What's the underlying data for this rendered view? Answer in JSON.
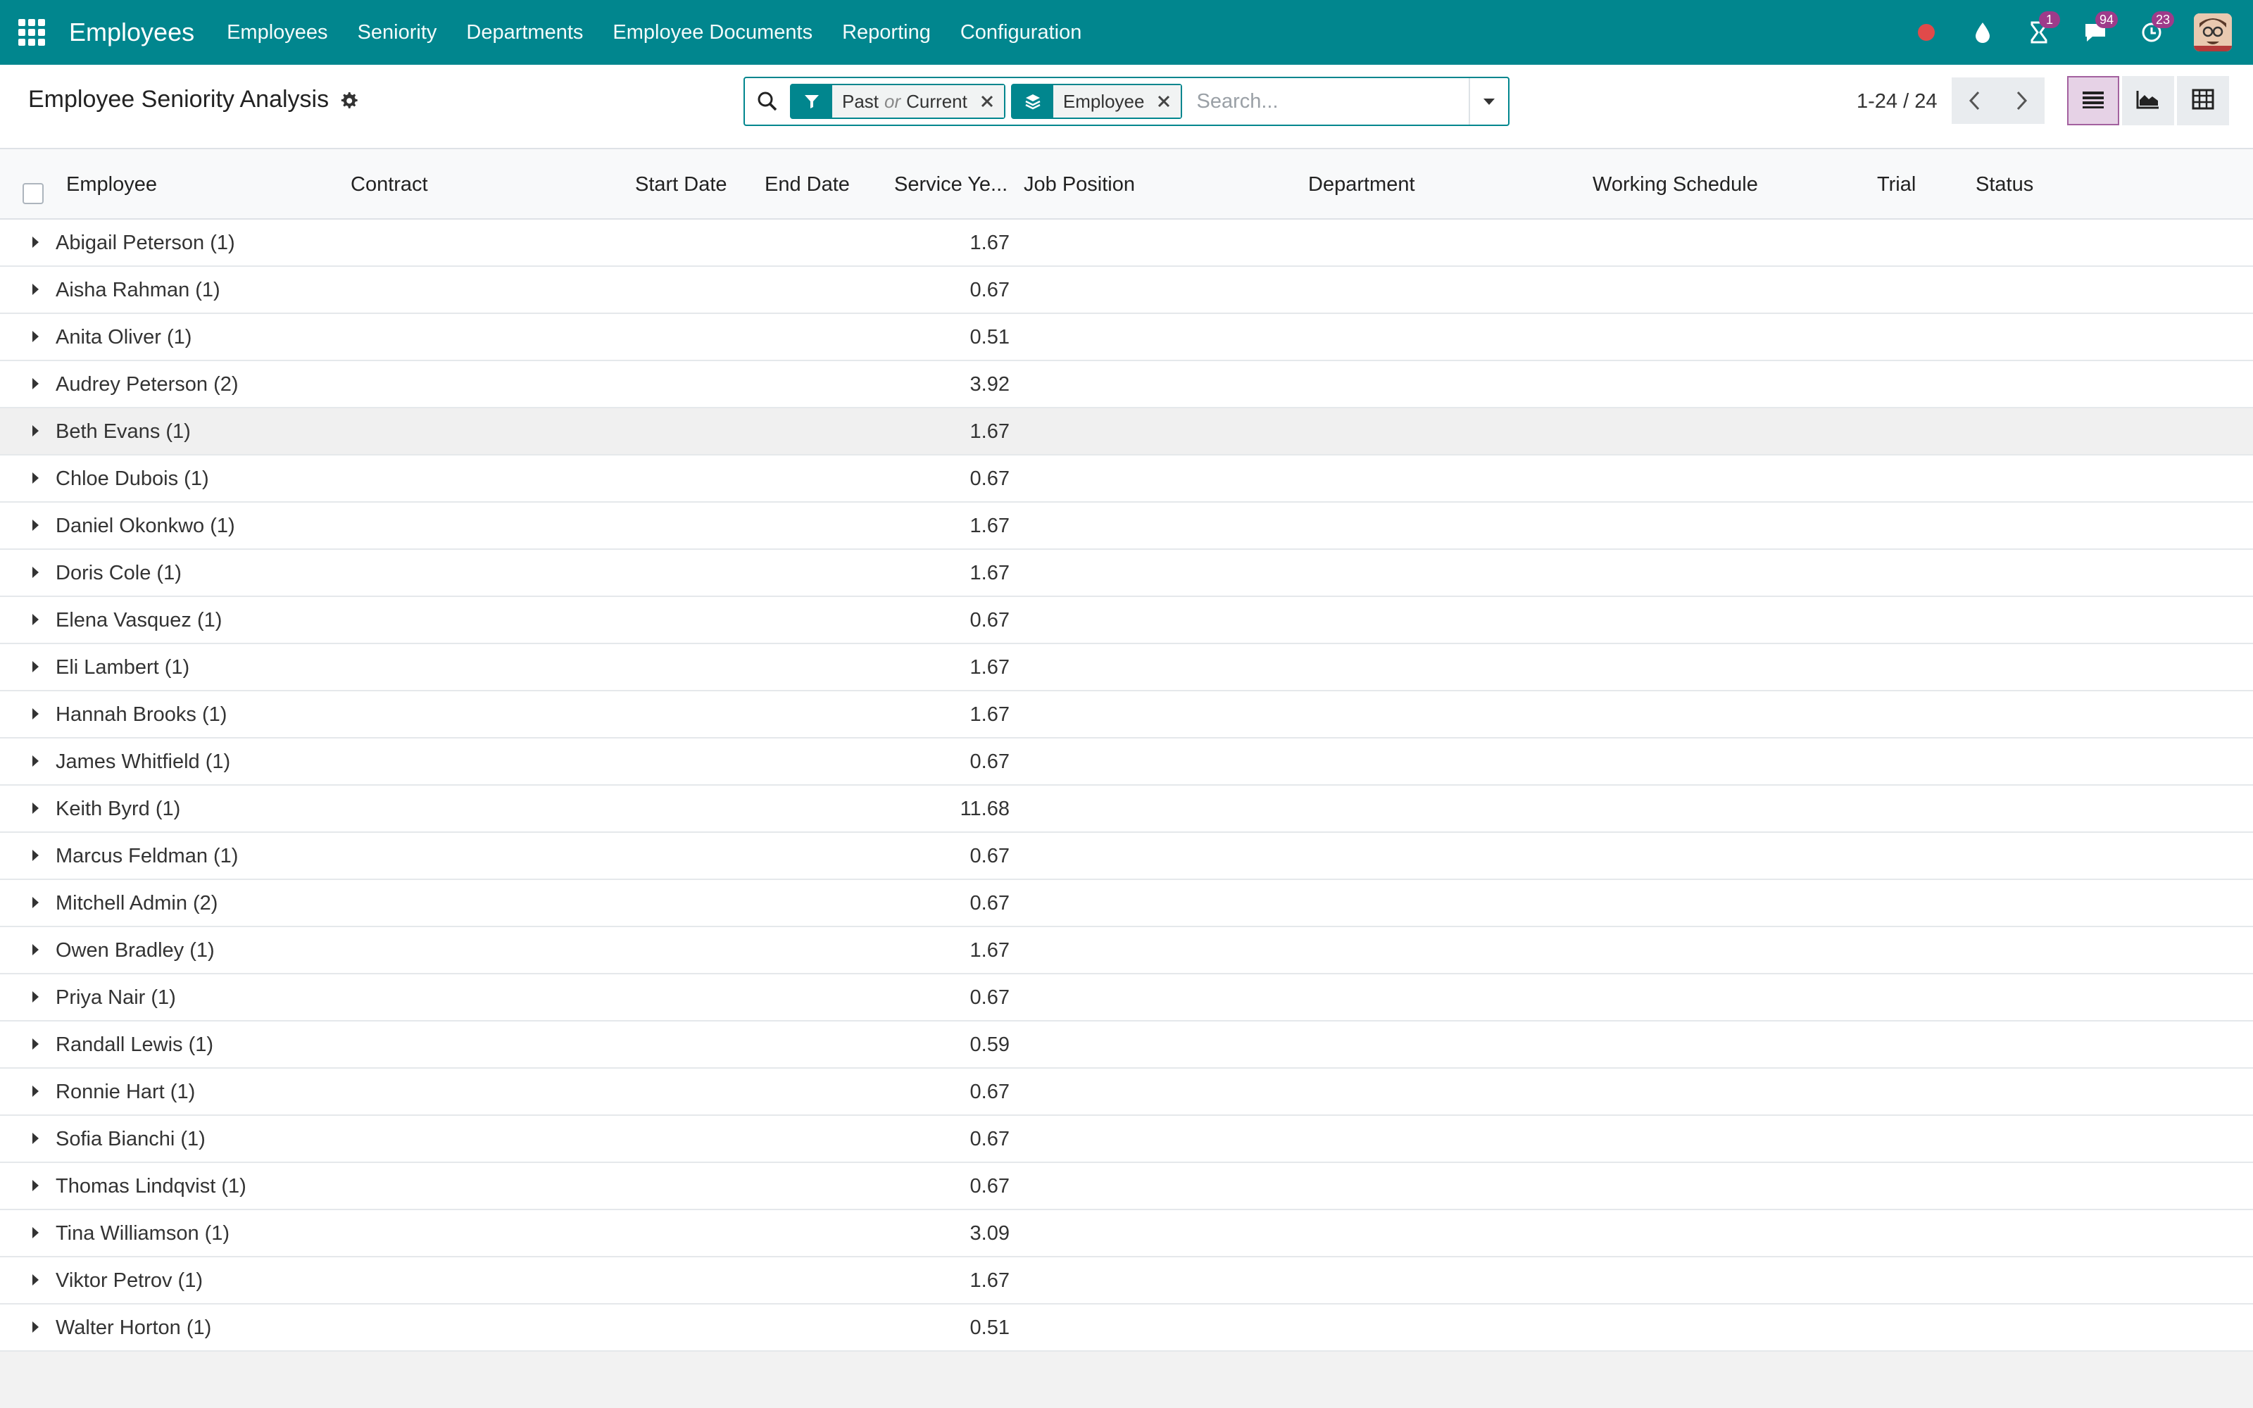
{
  "navbar": {
    "brand": "Employees",
    "menu": [
      "Employees",
      "Seniority",
      "Departments",
      "Employee Documents",
      "Reporting",
      "Configuration"
    ],
    "activity_badge": "1",
    "messages_badge": "94",
    "timesheet_badge": "23"
  },
  "control": {
    "title": "Employee Seniority Analysis",
    "filter_facet": {
      "value1": "Past",
      "or": "or",
      "value2": "Current"
    },
    "groupby_facet": {
      "value": "Employee"
    },
    "search_placeholder": "Search...",
    "pager": "1-24 / 24"
  },
  "table": {
    "columns": [
      "Employee",
      "Contract",
      "Start Date",
      "End Date",
      "Service Ye...",
      "Job Position",
      "Department",
      "Working Schedule",
      "Trial",
      "Status"
    ],
    "rows": [
      {
        "label": "Abigail Peterson (1)",
        "value": "1.67"
      },
      {
        "label": "Aisha Rahman (1)",
        "value": "0.67"
      },
      {
        "label": "Anita Oliver (1)",
        "value": "0.51"
      },
      {
        "label": "Audrey Peterson (2)",
        "value": "3.92"
      },
      {
        "label": "Beth Evans (1)",
        "value": "1.67"
      },
      {
        "label": "Chloe Dubois (1)",
        "value": "0.67"
      },
      {
        "label": "Daniel Okonkwo (1)",
        "value": "1.67"
      },
      {
        "label": "Doris Cole (1)",
        "value": "1.67"
      },
      {
        "label": "Elena Vasquez (1)",
        "value": "0.67"
      },
      {
        "label": "Eli Lambert (1)",
        "value": "1.67"
      },
      {
        "label": "Hannah Brooks (1)",
        "value": "1.67"
      },
      {
        "label": "James Whitfield (1)",
        "value": "0.67"
      },
      {
        "label": "Keith Byrd (1)",
        "value": "11.68"
      },
      {
        "label": "Marcus Feldman (1)",
        "value": "0.67"
      },
      {
        "label": "Mitchell Admin (2)",
        "value": "0.67"
      },
      {
        "label": "Owen Bradley (1)",
        "value": "1.67"
      },
      {
        "label": "Priya Nair (1)",
        "value": "0.67"
      },
      {
        "label": "Randall Lewis (1)",
        "value": "0.59"
      },
      {
        "label": "Ronnie Hart (1)",
        "value": "0.67"
      },
      {
        "label": "Sofia Bianchi (1)",
        "value": "0.67"
      },
      {
        "label": "Thomas Lindqvist (1)",
        "value": "0.67"
      },
      {
        "label": "Tina Williamson (1)",
        "value": "3.09"
      },
      {
        "label": "Viktor Petrov (1)",
        "value": "1.67"
      },
      {
        "label": "Walter Horton (1)",
        "value": "0.51"
      }
    ]
  }
}
